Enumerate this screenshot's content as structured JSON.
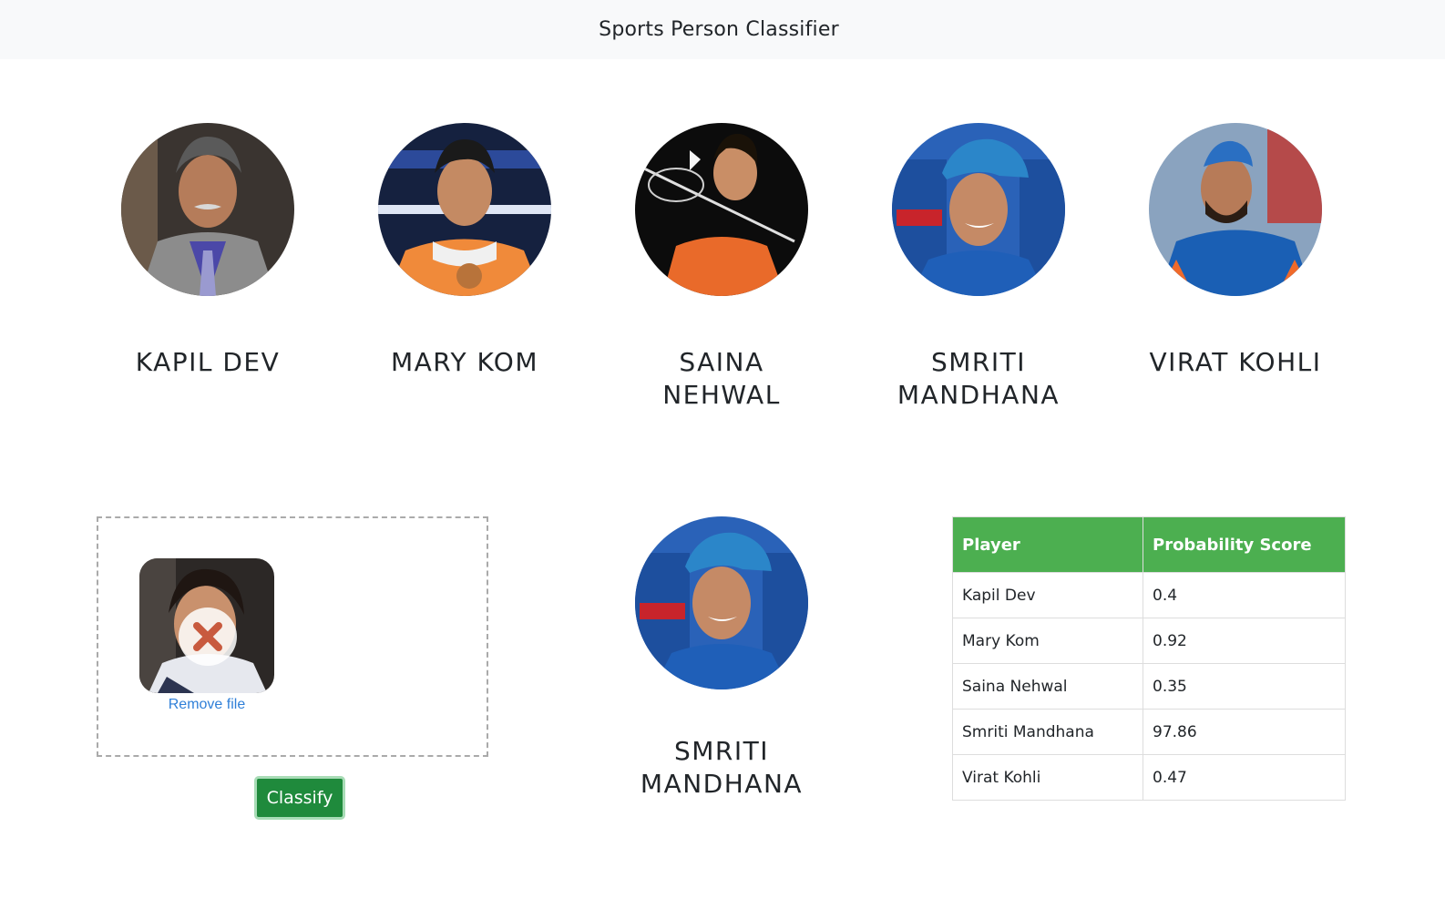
{
  "navbar": {
    "brand": "Sports Person Classifier"
  },
  "players": [
    {
      "name_line1": "KAPIL DEV",
      "name_line2": "",
      "photo": "kapil-dev-photo"
    },
    {
      "name_line1": "MARY KOM",
      "name_line2": "",
      "photo": "mary-kom-photo"
    },
    {
      "name_line1": "SAINA",
      "name_line2": "NEHWAL",
      "photo": "saina-nehwal-photo"
    },
    {
      "name_line1": "SMRITI",
      "name_line2": "MANDHANA",
      "photo": "smriti-mandhana-photo"
    },
    {
      "name_line1": "VIRAT KOHLI",
      "name_line2": "",
      "photo": "virat-kohli-photo"
    }
  ],
  "dropzone": {
    "remove_label": "Remove file",
    "preview": "uploaded-image-thumbnail"
  },
  "classify_button": {
    "label": "Classify",
    "color": "#1f8a3c"
  },
  "result": {
    "name": "SMRITI MANDHANA",
    "photo": "smriti-mandhana-photo"
  },
  "score_table": {
    "header_color": "#4caf50",
    "headers": [
      "Player",
      "Probability Score"
    ],
    "rows": [
      {
        "player": "Kapil Dev",
        "score": "0.4"
      },
      {
        "player": "Mary Kom",
        "score": "0.92"
      },
      {
        "player": "Saina Nehwal",
        "score": "0.35"
      },
      {
        "player": "Smriti Mandhana",
        "score": "97.86"
      },
      {
        "player": "Virat Kohli",
        "score": "0.47"
      }
    ]
  }
}
